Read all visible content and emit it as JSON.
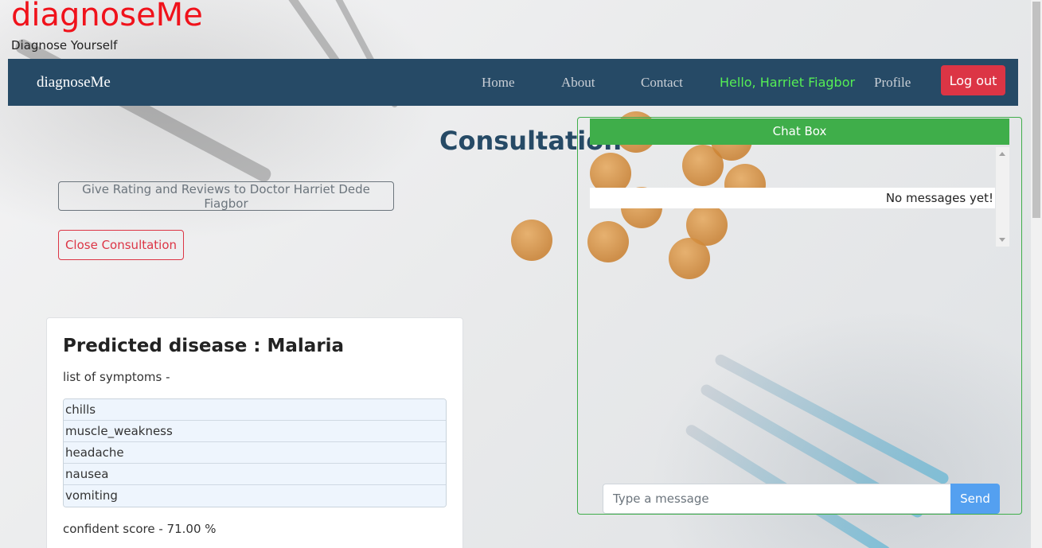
{
  "site": {
    "brand": "diagnoseMe",
    "tagline": "Diagnose Yourself"
  },
  "nav": {
    "brand": "diagnoseMe",
    "links": [
      "Home",
      "About",
      "Contact"
    ],
    "greeting": "Hello, Harriet Fiagbor",
    "profile": "Profile",
    "logout": "Log out"
  },
  "page": {
    "title": "Consultation",
    "rate_button": "Give Rating and Reviews to Doctor Harriet Dede Fiagbor",
    "close_button": "Close Consultation"
  },
  "prediction": {
    "title": "Predicted disease : Malaria",
    "symptoms_label": "list of symptoms -",
    "symptoms": [
      "chills",
      "muscle_weakness",
      "headache",
      "nausea",
      "vomiting"
    ],
    "score": "confident score - 71.00 %"
  },
  "chat": {
    "header": "Chat Box",
    "empty_message": "No messages yet!",
    "input_placeholder": "Type a message",
    "send_label": "Send"
  },
  "colors": {
    "brand_red": "#f0121b",
    "navbar": "#264a66",
    "greeting_green": "#55ee55",
    "danger": "#dc3545",
    "chat_green": "#3fae4a",
    "send_blue": "#54a0f0"
  }
}
